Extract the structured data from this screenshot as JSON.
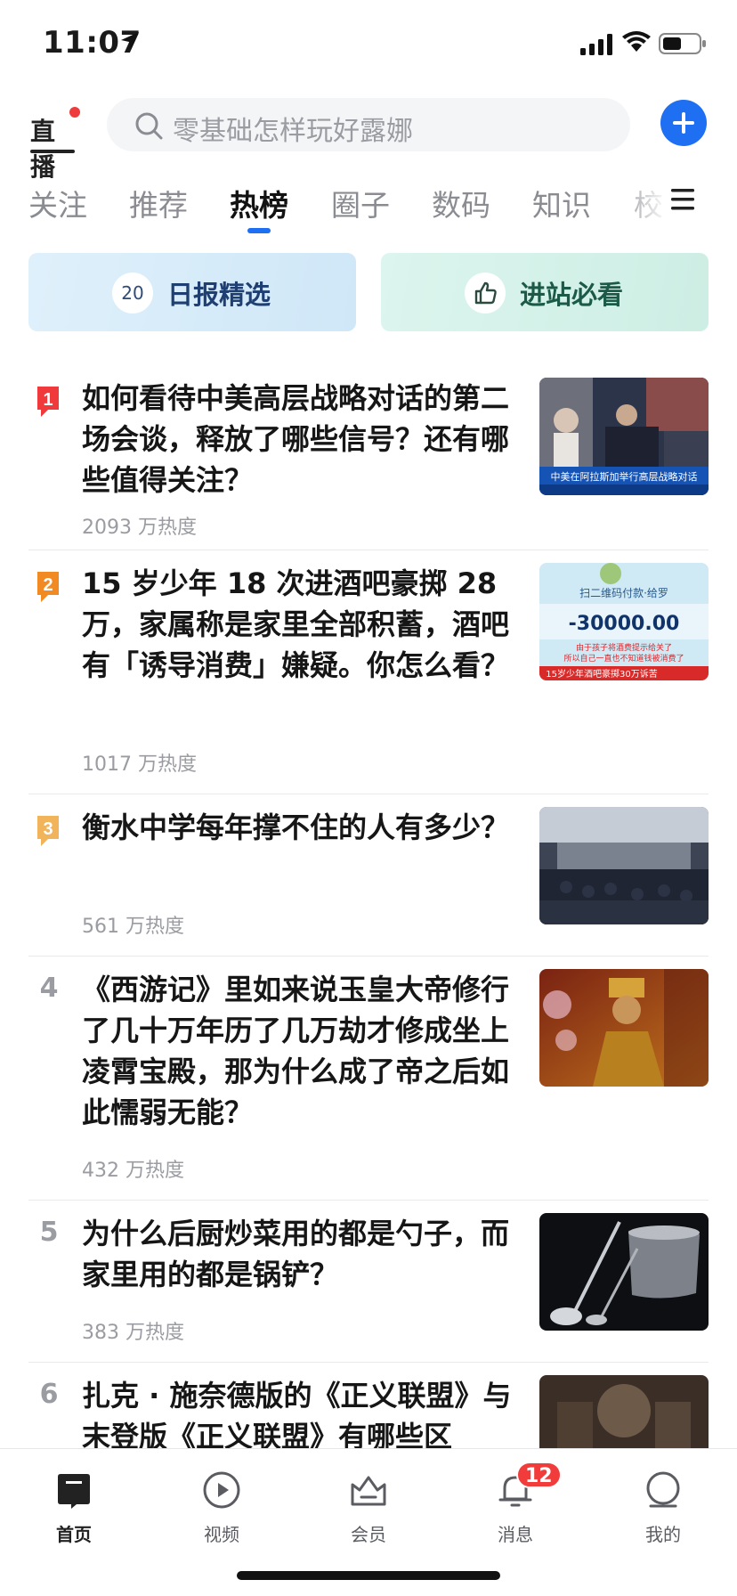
{
  "status_bar": {
    "time": "11:07",
    "icons": [
      "location-arrow-icon",
      "signal-icon",
      "wifi-icon",
      "battery-icon"
    ]
  },
  "header": {
    "live_logo": "直播",
    "search_placeholder": "零基础怎样玩好露娜",
    "search_icon": "search-icon",
    "add_icon": "plus-icon",
    "accent": "#1f6ff2"
  },
  "tabs": {
    "items": [
      "关注",
      "推荐",
      "热榜",
      "圈子",
      "数码",
      "知识",
      "校"
    ],
    "active": "热榜",
    "menu_icon": "menu-icon"
  },
  "cards": {
    "daily": {
      "badge": "20",
      "label": "日报精选"
    },
    "must_see": {
      "icon": "thumbs-up-icon",
      "label": "进站必看"
    }
  },
  "hot_list": [
    {
      "rank": "1",
      "title": "如何看待中美高层战略对话的第二场会谈，释放了哪些信号？还有哪些值得关注？",
      "heat": "2093 万热度",
      "badge_color": "#f0393a"
    },
    {
      "rank": "2",
      "title": "15 岁少年 18 次进酒吧豪掷 28 万，家属称是家里全部积蓄，酒吧有「诱导消费」嫌疑。你怎么看？",
      "heat": "1017 万热度",
      "badge_color": "#f28a24"
    },
    {
      "rank": "3",
      "title": "衡水中学每年撑不住的人有多少？",
      "heat": "561 万热度",
      "badge_color": "#f2b45a"
    },
    {
      "rank": "4",
      "title": "《西游记》里如来说玉皇大帝修行了几十万年历了几万劫才修成坐上凌霄宝殿，那为什么成了帝之后如此懦弱无能？",
      "heat": "432 万热度"
    },
    {
      "rank": "5",
      "title": "为什么后厨炒菜用的都是勺子，而家里用的都是锅铲？",
      "heat": "383 万热度"
    },
    {
      "rank": "6",
      "title": "扎克 · 施奈德版的《正义联盟》与末登版《正义联盟》有哪些区",
      "heat": ""
    }
  ],
  "thumb_texts": {
    "t1_banner": "中美在阿拉斯加举行高层战略对话",
    "t2_payment": "扫二维码付款·给罗",
    "t2_amount": "-30000.00",
    "t2_caption1": "由于孩子将酒费提示给关了",
    "t2_caption2": "所以自己一直也不知道钱被消费了",
    "t2_title": "15岁少年酒吧豪掷30万诉苦"
  },
  "bottom_nav": [
    {
      "label": "首页",
      "icon": "home-icon",
      "active": true
    },
    {
      "label": "视频",
      "icon": "play-icon",
      "active": false
    },
    {
      "label": "会员",
      "icon": "crown-icon",
      "active": false
    },
    {
      "label": "消息",
      "icon": "bell-icon",
      "active": false,
      "badge": "12"
    },
    {
      "label": "我的",
      "icon": "profile-icon",
      "active": false
    }
  ]
}
